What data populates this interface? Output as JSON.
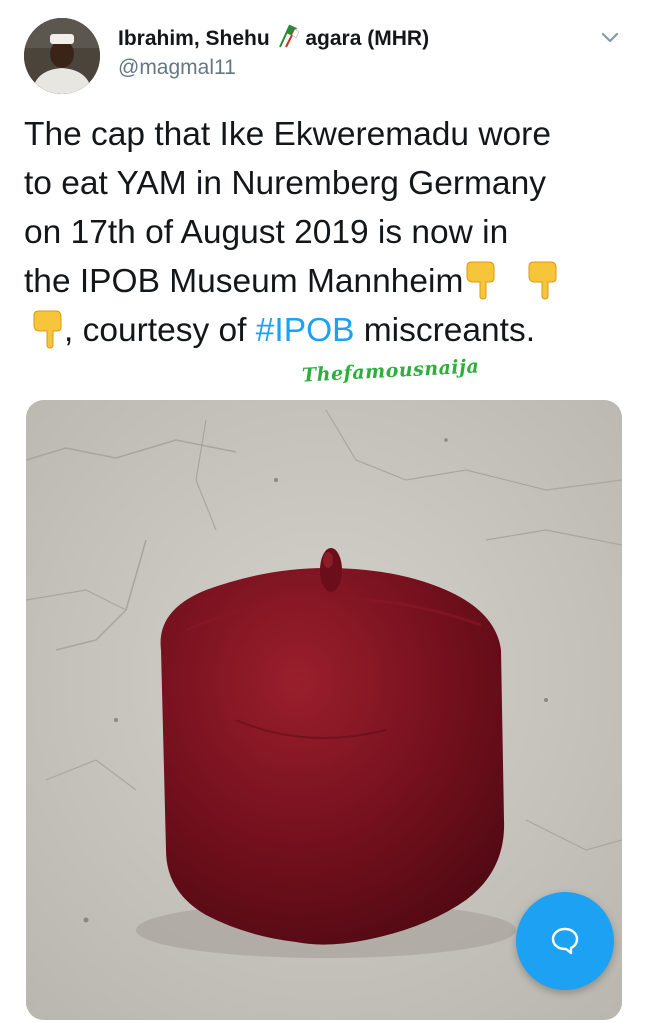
{
  "tweet": {
    "author": {
      "name_part1": "Ibrahim, Shehu",
      "name_flag_icon": "nigeria-flag-icon",
      "name_part2": "agara (MHR)",
      "handle": "@magmal11"
    },
    "text": {
      "line1": "The cap that Ike Ekweremadu wore",
      "line2": "to eat YAM in Nuremberg Germany",
      "line3": "on 17th of August 2019 is now in",
      "line4": "the IPOB Museum Mannheim",
      "line5_prefix": ", courtesy of ",
      "hashtag": "#IPOB",
      "line5_suffix": " miscreants.",
      "emoji_icon": "backhand-index-pointing-down-icon"
    },
    "watermark": "Thefamousnaija",
    "media": {
      "subject": "maroon-cap-photo"
    }
  },
  "ui": {
    "menu_icon": "chevron-down-icon",
    "fab_icon": "reply-bubble-icon",
    "colors": {
      "accent": "#1da1f2",
      "text": "#14171a",
      "secondary": "#657786",
      "cap": "#7a0f1c",
      "watermark": "#2eae3c"
    }
  }
}
